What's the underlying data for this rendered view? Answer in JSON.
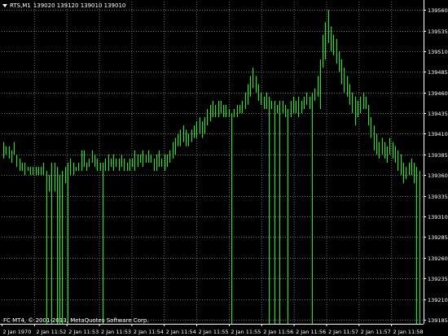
{
  "header": {
    "symbol": "RTS,M1",
    "ohlc": "139020 139120 139010 139010"
  },
  "copyright": "FC MT4, © 2001-2013, MetaQuotes Software Corp.",
  "colors": {
    "background": "#000000",
    "bars": "#00ff00",
    "grid": "#6f6f6f",
    "axis": "#ffffff"
  },
  "chart_data": {
    "type": "bar",
    "style": "ohlc-bars",
    "grid": true,
    "ylim": [
      139180,
      139570
    ],
    "y_ticks": [
      139560,
      139535,
      139510,
      139485,
      139460,
      139435,
      139410,
      139385,
      139360,
      139335,
      139310,
      139285,
      139260,
      139235,
      139210,
      139185
    ],
    "x_tick_labels": [
      "2 Jan 1970",
      "2 Jan 11:52",
      "2 Jan 11:53",
      "2 Jan 11:53",
      "2 Jan 11:54",
      "2 Jan 11:54",
      "2 Jan 11:55",
      "2 Jan 11:55",
      "2 Jan 11:56",
      "2 Jan 11:56",
      "2 Jan 11:57",
      "2 Jan 11:57",
      "2 Jan 11:58"
    ],
    "bars": [
      {
        "high": 139400,
        "low": 139380
      },
      {
        "high": 139395,
        "low": 139385
      },
      {
        "high": 139395,
        "low": 139380
      },
      {
        "high": 139390,
        "low": 139375
      },
      {
        "high": 139400,
        "low": 139385
      },
      {
        "high": 139385,
        "low": 139370
      },
      {
        "high": 139380,
        "low": 139365
      },
      {
        "high": 139375,
        "low": 139365
      },
      {
        "high": 139375,
        "low": 139360
      },
      {
        "high": 139370,
        "low": 139365
      },
      {
        "high": 139370,
        "low": 139360
      },
      {
        "high": 139370,
        "low": 139360
      },
      {
        "high": 139370,
        "low": 139360
      },
      {
        "high": 139370,
        "low": 139360
      },
      {
        "high": 139370,
        "low": 139360
      },
      {
        "high": 139375,
        "low": 139360
      },
      {
        "high": 139365,
        "low": 139180
      },
      {
        "high": 139360,
        "low": 139340
      },
      {
        "high": 139375,
        "low": 139180
      },
      {
        "high": 139375,
        "low": 139340
      },
      {
        "high": 139370,
        "low": 139180
      },
      {
        "high": 139360,
        "low": 139180
      },
      {
        "high": 139365,
        "low": 139180
      },
      {
        "high": 139370,
        "low": 139350
      },
      {
        "high": 139375,
        "low": 139180
      },
      {
        "high": 139380,
        "low": 139360
      },
      {
        "high": 139375,
        "low": 139360
      },
      {
        "high": 139370,
        "low": 139365
      },
      {
        "high": 139375,
        "low": 139365
      },
      {
        "high": 139390,
        "low": 139365
      },
      {
        "high": 139390,
        "low": 139370
      },
      {
        "high": 139375,
        "low": 139365
      },
      {
        "high": 139380,
        "low": 139370
      },
      {
        "high": 139390,
        "low": 139375
      },
      {
        "high": 139385,
        "low": 139370
      },
      {
        "high": 139380,
        "low": 139365
      },
      {
        "high": 139375,
        "low": 139365
      },
      {
        "high": 139375,
        "low": 139180
      },
      {
        "high": 139380,
        "low": 139365
      },
      {
        "high": 139385,
        "low": 139365
      },
      {
        "high": 139380,
        "low": 139370
      },
      {
        "high": 139385,
        "low": 139365
      },
      {
        "high": 139380,
        "low": 139370
      },
      {
        "high": 139380,
        "low": 139365
      },
      {
        "high": 139385,
        "low": 139370
      },
      {
        "high": 139380,
        "low": 139365
      },
      {
        "high": 139375,
        "low": 139365
      },
      {
        "high": 139380,
        "low": 139365
      },
      {
        "high": 139380,
        "low": 139370
      },
      {
        "high": 139390,
        "low": 139365
      },
      {
        "high": 139385,
        "low": 139370
      },
      {
        "high": 139385,
        "low": 139375
      },
      {
        "high": 139390,
        "low": 139370
      },
      {
        "high": 139385,
        "low": 139375
      },
      {
        "high": 139390,
        "low": 139375
      },
      {
        "high": 139385,
        "low": 139375
      },
      {
        "high": 139380,
        "low": 139365
      },
      {
        "high": 139385,
        "low": 139365
      },
      {
        "high": 139390,
        "low": 139370
      },
      {
        "high": 139380,
        "low": 139370
      },
      {
        "high": 139385,
        "low": 139365
      },
      {
        "high": 139385,
        "low": 139370
      },
      {
        "high": 139390,
        "low": 139375
      },
      {
        "high": 139400,
        "low": 139380
      },
      {
        "high": 139405,
        "low": 139385
      },
      {
        "high": 139410,
        "low": 139395
      },
      {
        "high": 139415,
        "low": 139395
      },
      {
        "high": 139420,
        "low": 139400
      },
      {
        "high": 139415,
        "low": 139395
      },
      {
        "high": 139410,
        "low": 139395
      },
      {
        "high": 139415,
        "low": 139400
      },
      {
        "high": 139420,
        "low": 139405
      },
      {
        "high": 139425,
        "low": 139405
      },
      {
        "high": 139430,
        "low": 139410
      },
      {
        "high": 139425,
        "low": 139405
      },
      {
        "high": 139430,
        "low": 139410
      },
      {
        "high": 139440,
        "low": 139420
      },
      {
        "high": 139445,
        "low": 139425
      },
      {
        "high": 139450,
        "low": 139430
      },
      {
        "high": 139445,
        "low": 139430
      },
      {
        "high": 139450,
        "low": 139430
      },
      {
        "high": 139450,
        "low": 139435
      },
      {
        "high": 139445,
        "low": 139430
      },
      {
        "high": 139445,
        "low": 139430
      },
      {
        "high": 139440,
        "low": 139430
      },
      {
        "high": 139435,
        "low": 139180
      },
      {
        "high": 139440,
        "low": 139430
      },
      {
        "high": 139445,
        "low": 139430
      },
      {
        "high": 139445,
        "low": 139435
      },
      {
        "high": 139450,
        "low": 139435
      },
      {
        "high": 139460,
        "low": 139440
      },
      {
        "high": 139470,
        "low": 139445
      },
      {
        "high": 139480,
        "low": 139455
      },
      {
        "high": 139490,
        "low": 139465
      },
      {
        "high": 139480,
        "low": 139460
      },
      {
        "high": 139470,
        "low": 139450
      },
      {
        "high": 139460,
        "low": 139445
      },
      {
        "high": 139455,
        "low": 139440
      },
      {
        "high": 139460,
        "low": 139440
      },
      {
        "high": 139455,
        "low": 139180
      },
      {
        "high": 139450,
        "low": 139440
      },
      {
        "high": 139450,
        "low": 139180
      },
      {
        "high": 139445,
        "low": 139435
      },
      {
        "high": 139450,
        "low": 139180
      },
      {
        "high": 139450,
        "low": 139435
      },
      {
        "high": 139445,
        "low": 139430
      },
      {
        "high": 139440,
        "low": 139180
      },
      {
        "high": 139450,
        "low": 139430
      },
      {
        "high": 139455,
        "low": 139435
      },
      {
        "high": 139450,
        "low": 139435
      },
      {
        "high": 139455,
        "low": 139430
      },
      {
        "high": 139450,
        "low": 139435
      },
      {
        "high": 139455,
        "low": 139440
      },
      {
        "high": 139460,
        "low": 139445
      },
      {
        "high": 139455,
        "low": 139440
      },
      {
        "high": 139460,
        "low": 139180
      },
      {
        "high": 139465,
        "low": 139450
      },
      {
        "high": 139480,
        "low": 139455
      },
      {
        "high": 139500,
        "low": 139440
      },
      {
        "high": 139530,
        "low": 139490
      },
      {
        "high": 139545,
        "low": 139500
      },
      {
        "high": 139560,
        "low": 139520
      },
      {
        "high": 139540,
        "low": 139510
      },
      {
        "high": 139530,
        "low": 139505
      },
      {
        "high": 139525,
        "low": 139495
      },
      {
        "high": 139510,
        "low": 139485
      },
      {
        "high": 139500,
        "low": 139470
      },
      {
        "high": 139490,
        "low": 139460
      },
      {
        "high": 139480,
        "low": 139455
      },
      {
        "high": 139470,
        "low": 139445
      },
      {
        "high": 139460,
        "low": 139435
      },
      {
        "high": 139455,
        "low": 139420
      },
      {
        "high": 139450,
        "low": 139430
      },
      {
        "high": 139455,
        "low": 139435
      },
      {
        "high": 139460,
        "low": 139440
      },
      {
        "high": 139455,
        "low": 139440
      },
      {
        "high": 139445,
        "low": 139420
      },
      {
        "high": 139430,
        "low": 139405
      },
      {
        "high": 139420,
        "low": 139390
      },
      {
        "high": 139410,
        "low": 139385
      },
      {
        "high": 139400,
        "low": 139380
      },
      {
        "high": 139405,
        "low": 139385
      },
      {
        "high": 139400,
        "low": 139380
      },
      {
        "high": 139395,
        "low": 139375
      },
      {
        "high": 139405,
        "low": 139385
      },
      {
        "high": 139400,
        "low": 139380
      },
      {
        "high": 139395,
        "low": 139375
      },
      {
        "high": 139390,
        "low": 139365
      },
      {
        "high": 139385,
        "low": 139360
      },
      {
        "high": 139375,
        "low": 139350
      },
      {
        "high": 139370,
        "low": 139355
      },
      {
        "high": 139375,
        "low": 139360
      },
      {
        "high": 139380,
        "low": 139360
      },
      {
        "high": 139375,
        "low": 139350
      },
      {
        "high": 139370,
        "low": 139180
      },
      {
        "high": 139365,
        "low": 139180
      }
    ]
  }
}
